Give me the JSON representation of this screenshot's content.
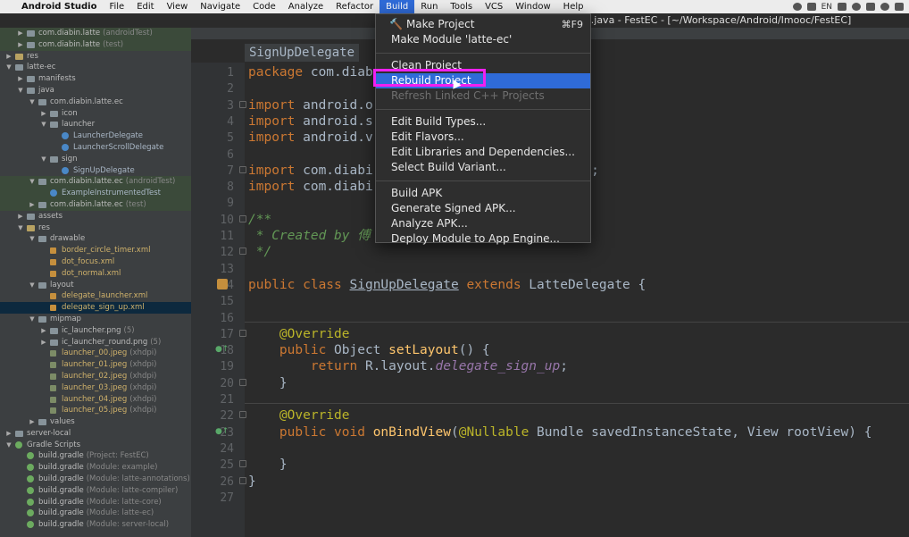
{
  "menubar": {
    "apple": "",
    "app_name": "Android Studio",
    "items": [
      "File",
      "Edit",
      "View",
      "Navigate",
      "Code",
      "Analyze",
      "Refactor",
      "Build",
      "Run",
      "Tools",
      "VCS",
      "Window",
      "Help"
    ],
    "active": "Build",
    "status": "EN"
  },
  "window_title": "e.java - FestEC - [~/Workspace/Android/Imooc/FestEC]",
  "tree": [
    {
      "arrow": "right",
      "indent": 1,
      "icon": "pkg",
      "label": "com.diabin.latte",
      "sub": "(androidTest)",
      "style": "green"
    },
    {
      "arrow": "right",
      "indent": 1,
      "icon": "pkg",
      "label": "com.diabin.latte",
      "sub": "(test)",
      "style": "green"
    },
    {
      "arrow": "right",
      "indent": 0,
      "icon": "res",
      "label": "res",
      "sub": ""
    },
    {
      "arrow": "down",
      "indent": 0,
      "icon": "folder",
      "label": "latte-ec",
      "sub": ""
    },
    {
      "arrow": "right",
      "indent": 1,
      "icon": "folder",
      "label": "manifests",
      "sub": ""
    },
    {
      "arrow": "down",
      "indent": 1,
      "icon": "folder",
      "label": "java",
      "sub": ""
    },
    {
      "arrow": "down",
      "indent": 2,
      "icon": "pkg",
      "label": "com.diabin.latte.ec",
      "sub": ""
    },
    {
      "arrow": "right",
      "indent": 3,
      "icon": "pkg",
      "label": "icon",
      "sub": ""
    },
    {
      "arrow": "down",
      "indent": 3,
      "icon": "pkg",
      "label": "launcher",
      "sub": ""
    },
    {
      "arrow": "",
      "indent": 4,
      "icon": "cls",
      "label": "LauncherDelegate",
      "sub": "",
      "kind": "cls"
    },
    {
      "arrow": "",
      "indent": 4,
      "icon": "cls",
      "label": "LauncherScrollDelegate",
      "sub": "",
      "kind": "cls"
    },
    {
      "arrow": "down",
      "indent": 3,
      "icon": "pkg",
      "label": "sign",
      "sub": ""
    },
    {
      "arrow": "",
      "indent": 4,
      "icon": "cls",
      "label": "SignUpDelegate",
      "sub": "",
      "kind": "cls"
    },
    {
      "arrow": "down",
      "indent": 2,
      "icon": "pkg",
      "label": "com.diabin.latte.ec",
      "sub": "(androidTest)",
      "style": "green"
    },
    {
      "arrow": "",
      "indent": 3,
      "icon": "cls",
      "label": "ExampleInstrumentedTest",
      "sub": "",
      "kind": "cls",
      "style": "green"
    },
    {
      "arrow": "right",
      "indent": 2,
      "icon": "pkg",
      "label": "com.diabin.latte.ec",
      "sub": "(test)",
      "style": "green"
    },
    {
      "arrow": "right",
      "indent": 1,
      "icon": "folder",
      "label": "assets",
      "sub": ""
    },
    {
      "arrow": "down",
      "indent": 1,
      "icon": "res",
      "label": "res",
      "sub": ""
    },
    {
      "arrow": "down",
      "indent": 2,
      "icon": "folder",
      "label": "drawable",
      "sub": ""
    },
    {
      "arrow": "",
      "indent": 3,
      "icon": "xml",
      "label": "border_circle_timer.xml",
      "sub": "",
      "kind": "xml"
    },
    {
      "arrow": "",
      "indent": 3,
      "icon": "xml",
      "label": "dot_focus.xml",
      "sub": "",
      "kind": "xml"
    },
    {
      "arrow": "",
      "indent": 3,
      "icon": "xml",
      "label": "dot_normal.xml",
      "sub": "",
      "kind": "xml"
    },
    {
      "arrow": "down",
      "indent": 2,
      "icon": "folder",
      "label": "layout",
      "sub": ""
    },
    {
      "arrow": "",
      "indent": 3,
      "icon": "xml",
      "label": "delegate_launcher.xml",
      "sub": "",
      "kind": "xml"
    },
    {
      "arrow": "",
      "indent": 3,
      "icon": "xml",
      "label": "delegate_sign_up.xml",
      "sub": "",
      "kind": "xml",
      "style": "selected"
    },
    {
      "arrow": "down",
      "indent": 2,
      "icon": "folder",
      "label": "mipmap",
      "sub": ""
    },
    {
      "arrow": "right",
      "indent": 3,
      "icon": "folder",
      "label": "ic_launcher.png",
      "sub": "(5)"
    },
    {
      "arrow": "right",
      "indent": 3,
      "icon": "folder",
      "label": "ic_launcher_round.png",
      "sub": "(5)"
    },
    {
      "arrow": "",
      "indent": 3,
      "icon": "img",
      "label": "launcher_00.jpeg",
      "sub": "(xhdpi)",
      "kind": "xml"
    },
    {
      "arrow": "",
      "indent": 3,
      "icon": "img",
      "label": "launcher_01.jpeg",
      "sub": "(xhdpi)",
      "kind": "xml"
    },
    {
      "arrow": "",
      "indent": 3,
      "icon": "img",
      "label": "launcher_02.jpeg",
      "sub": "(xhdpi)",
      "kind": "xml"
    },
    {
      "arrow": "",
      "indent": 3,
      "icon": "img",
      "label": "launcher_03.jpeg",
      "sub": "(xhdpi)",
      "kind": "xml"
    },
    {
      "arrow": "",
      "indent": 3,
      "icon": "img",
      "label": "launcher_04.jpeg",
      "sub": "(xhdpi)",
      "kind": "xml"
    },
    {
      "arrow": "",
      "indent": 3,
      "icon": "img",
      "label": "launcher_05.jpeg",
      "sub": "(xhdpi)",
      "kind": "xml"
    },
    {
      "arrow": "right",
      "indent": 2,
      "icon": "folder",
      "label": "values",
      "sub": ""
    },
    {
      "arrow": "right",
      "indent": 0,
      "icon": "folder",
      "label": "server-local",
      "sub": ""
    },
    {
      "arrow": "down",
      "indent": 0,
      "icon": "gradle",
      "label": "Gradle Scripts",
      "sub": ""
    },
    {
      "arrow": "",
      "indent": 1,
      "icon": "gradle",
      "label": "build.gradle",
      "sub": "(Project: FestEC)"
    },
    {
      "arrow": "",
      "indent": 1,
      "icon": "gradle",
      "label": "build.gradle",
      "sub": "(Module: example)"
    },
    {
      "arrow": "",
      "indent": 1,
      "icon": "gradle",
      "label": "build.gradle",
      "sub": "(Module: latte-annotations)"
    },
    {
      "arrow": "",
      "indent": 1,
      "icon": "gradle",
      "label": "build.gradle",
      "sub": "(Module: latte-compiler)"
    },
    {
      "arrow": "",
      "indent": 1,
      "icon": "gradle",
      "label": "build.gradle",
      "sub": "(Module: latte-core)"
    },
    {
      "arrow": "",
      "indent": 1,
      "icon": "gradle",
      "label": "build.gradle",
      "sub": "(Module: latte-ec)"
    },
    {
      "arrow": "",
      "indent": 1,
      "icon": "gradle",
      "label": "build.gradle",
      "sub": "(Module: server-local)"
    }
  ],
  "editor": {
    "breadcrumb": "SignUpDelegate",
    "line_numbers": [
      "1",
      "2",
      "3",
      "4",
      "5",
      "6",
      "7",
      "8",
      "9",
      "10",
      "11",
      "12",
      "13",
      "14",
      "15",
      "16",
      "17",
      "18",
      "19",
      "20",
      "21",
      "22",
      "23",
      "24",
      "25",
      "26",
      "27"
    ],
    "lines": [
      [
        [
          "kw",
          "package "
        ],
        [
          "",
          "com.diab"
        ]
      ],
      [],
      [
        [
          "kw",
          "import "
        ],
        [
          "",
          "android.o"
        ]
      ],
      [
        [
          "kw",
          "import "
        ],
        [
          "",
          "android.s"
        ]
      ],
      [
        [
          "kw",
          "import "
        ],
        [
          "",
          "android.v"
        ]
      ],
      [],
      [
        [
          "kw",
          "import "
        ],
        [
          "",
          "com.diabi"
        ],
        [
          "",
          "                        gate;"
        ]
      ],
      [
        [
          "kw",
          "import "
        ],
        [
          "",
          "com.diabi"
        ]
      ],
      [],
      [
        [
          "cmt",
          "/**"
        ]
      ],
      [
        [
          "cmt",
          " * Created by 傅"
        ]
      ],
      [
        [
          "cmt",
          " */"
        ]
      ],
      [],
      [
        [
          "kw",
          "public class "
        ],
        [
          "und",
          "SignUpDelegate"
        ],
        [
          "kw",
          " extends "
        ],
        [
          "",
          "LatteDelegate {"
        ]
      ],
      [],
      [],
      [
        [
          "ann",
          "    @Override"
        ]
      ],
      [
        [
          "kw",
          "    public "
        ],
        [
          "",
          "Object "
        ],
        [
          "fn",
          "setLayout"
        ],
        [
          "",
          "() {"
        ]
      ],
      [
        [
          "kw",
          "        return "
        ],
        [
          "",
          "R.layout."
        ],
        [
          "it",
          "delegate_sign_up"
        ],
        [
          "",
          ";"
        ]
      ],
      [
        [
          "",
          "    }"
        ]
      ],
      [],
      [
        [
          "ann",
          "    @Override"
        ]
      ],
      [
        [
          "kw",
          "    public void "
        ],
        [
          "fn",
          "onBindView"
        ],
        [
          "",
          "("
        ],
        [
          "ann",
          "@Nullable"
        ],
        [
          "",
          " Bundle savedInstanceState, View rootView) {"
        ]
      ],
      [],
      [
        [
          "",
          "    }"
        ]
      ],
      [
        [
          "",
          "}"
        ]
      ],
      []
    ]
  },
  "build_menu": {
    "items": [
      {
        "label": "Make Project",
        "shortcut": "⌘F9",
        "hammer": true
      },
      {
        "label": "Make Module 'latte-ec'"
      },
      {
        "sep": true
      },
      {
        "label": "Clean Project"
      },
      {
        "label": "Rebuild Project",
        "highlighted": true
      },
      {
        "label": "Refresh Linked C++ Projects",
        "disabled": true
      },
      {
        "sep": true
      },
      {
        "label": "Edit Build Types..."
      },
      {
        "label": "Edit Flavors..."
      },
      {
        "label": "Edit Libraries and Dependencies..."
      },
      {
        "label": "Select Build Variant..."
      },
      {
        "sep": true
      },
      {
        "label": "Build APK"
      },
      {
        "label": "Generate Signed APK..."
      },
      {
        "label": "Analyze APK..."
      },
      {
        "label": "Deploy Module to App Engine..."
      }
    ]
  },
  "colors": {
    "highlight": "#2f6bd8",
    "annotation_box": "#f020f0",
    "editor_bg": "#2b2b2b",
    "tree_bg": "#3c3f41"
  }
}
